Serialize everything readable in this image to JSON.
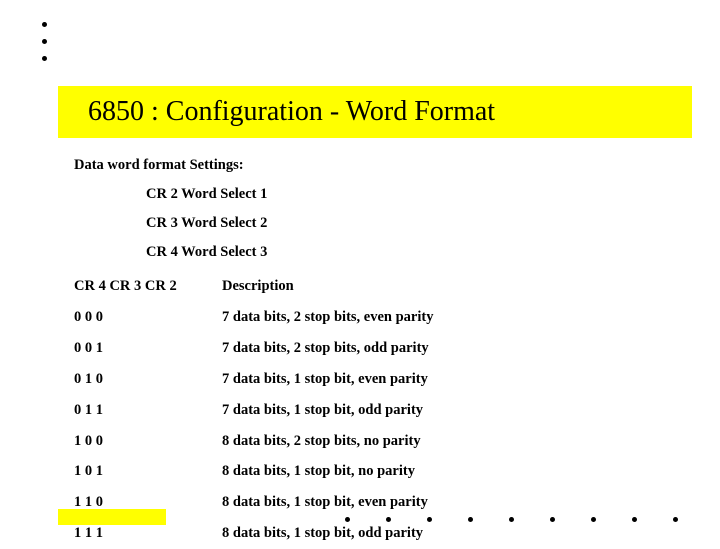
{
  "title": "6850 : Configuration - Word Format",
  "subhead": "Data word format Settings:",
  "cr_lines": {
    "a": "CR 2 Word Select 1",
    "b": "CR 3 Word Select 2",
    "c": "CR 4 Word Select 3"
  },
  "table": {
    "header": {
      "col0": "CR 4 CR 3 CR 2",
      "col1": "Description"
    },
    "rows": {
      "r0": {
        "c0": "0 0 0",
        "c1": "7 data bits, 2 stop bits, even parity"
      },
      "r1": {
        "c0": "0 0 1",
        "c1": "7 data bits, 2 stop bits, odd parity"
      },
      "r2": {
        "c0": "0 1 0",
        "c1": "7 data bits, 1 stop bit, even parity"
      },
      "r3": {
        "c0": "0 1 1",
        "c1": "7 data bits, 1 stop bit, odd parity"
      },
      "r4": {
        "c0": "1 0 0",
        "c1": "8 data bits, 2 stop bits, no parity"
      },
      "r5": {
        "c0": "1 0 1",
        "c1": "8 data bits, 1 stop bit, no parity"
      },
      "r6": {
        "c0": "1 1 0",
        "c1": "8 data bits, 1 stop bit, even parity"
      },
      "r7": {
        "c0": "1 1 1",
        "c1": "8 data bits, 1 stop bit, odd parity"
      }
    }
  }
}
